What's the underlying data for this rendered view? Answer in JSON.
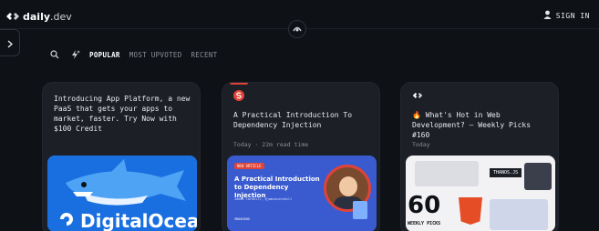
{
  "header": {
    "logo_main": "daily",
    "logo_suffix": ".dev",
    "signin_label": "SIGN IN"
  },
  "filters": {
    "tabs": [
      "POPULAR",
      "MOST UPVOTED",
      "RECENT"
    ]
  },
  "cards": [
    {
      "title": "Introducing App Platform, a new PaaS that gets your apps to market, faster. Try Now with $100 Credit",
      "image_text": "DigitalOcean"
    },
    {
      "title": "A Practical Introduction To Dependency Injection",
      "meta": "Today · 22m read time",
      "image_badge": "NEW ARTICLE",
      "image_heading": "A Practical Introduction to Dependency Injection",
      "image_author": "Jamie Corkhill, @jamiecorkhill",
      "image_brand": "SMASHING"
    },
    {
      "title": "🔥 What's Hot in Web Development? — Weekly Picks #160",
      "meta": "Today",
      "image_number": "60",
      "image_caption": "WEEKLY PICKS",
      "image_tag": "THANOS.JS"
    }
  ],
  "colors": {
    "background": "#0e1217",
    "card": "#1c1f26",
    "accent": "#e04337",
    "digitalocean_blue": "#0069ff"
  }
}
